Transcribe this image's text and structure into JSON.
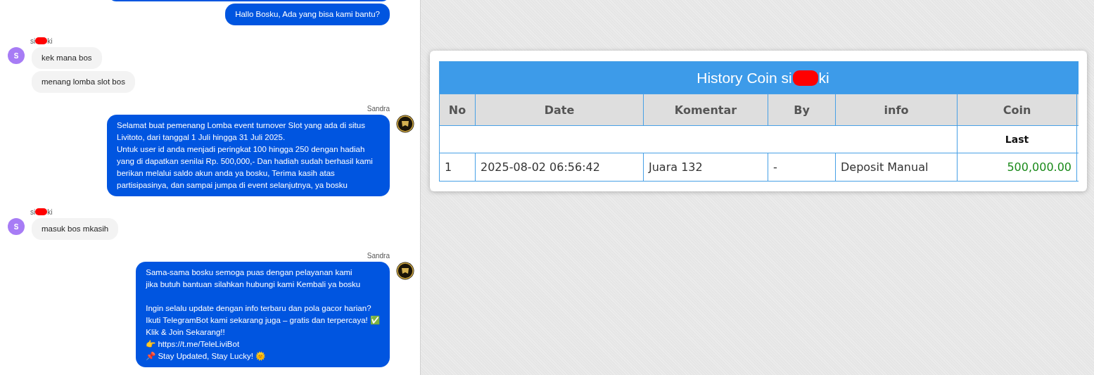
{
  "chat": {
    "messages": [
      {
        "kind": "agent_clipped"
      },
      {
        "kind": "agent_text",
        "text": "Hallo Bosku, Ada yang bisa kami bantu?"
      },
      {
        "kind": "user_sender",
        "name_start": "si",
        "name_end": "ki",
        "redacted": true,
        "avatar": "S"
      },
      {
        "kind": "user_text",
        "text": "kek mana bos"
      },
      {
        "kind": "user_text",
        "text": "menang lomba slot bos"
      },
      {
        "kind": "agent_sender",
        "name_start": "Sandra"
      },
      {
        "kind": "agent_text",
        "avatar": true,
        "text": "Selamat buat pemenang Lomba event turnover Slot yang ada di situs Livitoto, dari tanggal 1 Juli hingga 31 Juli 2025.\nUntuk user id anda menjadi peringkat 100 hingga 250 dengan hadiah yang di dapatkan senilai Rp. 500,000,- Dan hadiah sudah berhasil kami berikan melalui saldo akun anda ya bosku, Terima kasih atas partisipasinya, dan sampai jumpa di event selanjutnya, ya bosku"
      },
      {
        "kind": "user_sender",
        "name_start": "si",
        "name_end": "ki",
        "redacted": true,
        "avatar": "S"
      },
      {
        "kind": "user_text",
        "text": "masuk bos mkasih"
      },
      {
        "kind": "agent_sender",
        "name_start": "Sandra"
      },
      {
        "kind": "agent_text",
        "avatar": true,
        "text": "Sama-sama bosku semoga puas dengan pelayanan kami\njika butuh bantuan silahkan hubungi kami Kembali ya bosku\n\nIngin selalu update dengan info terbaru dan pola gacor harian?\nIkuti TelegramBot kami sekarang juga – gratis dan terpercaya! ✅\nKlik & Join Sekarang!!\n👉 https://t.me/TeleLiviBot\n📌 Stay Updated, Stay Lucky! 🌞"
      }
    ]
  },
  "history": {
    "title_start": "History Coin si",
    "title_end": "ki",
    "redacted": true,
    "columns": [
      "No",
      "Date",
      "Komentar",
      "By",
      "info",
      "Coin"
    ],
    "subheader": "Last",
    "rows": [
      {
        "cells": [
          "1",
          "2025-08-02 06:56:42",
          "Juara 132",
          "-",
          "Deposit Manual",
          "500,000.00"
        ]
      }
    ]
  }
}
